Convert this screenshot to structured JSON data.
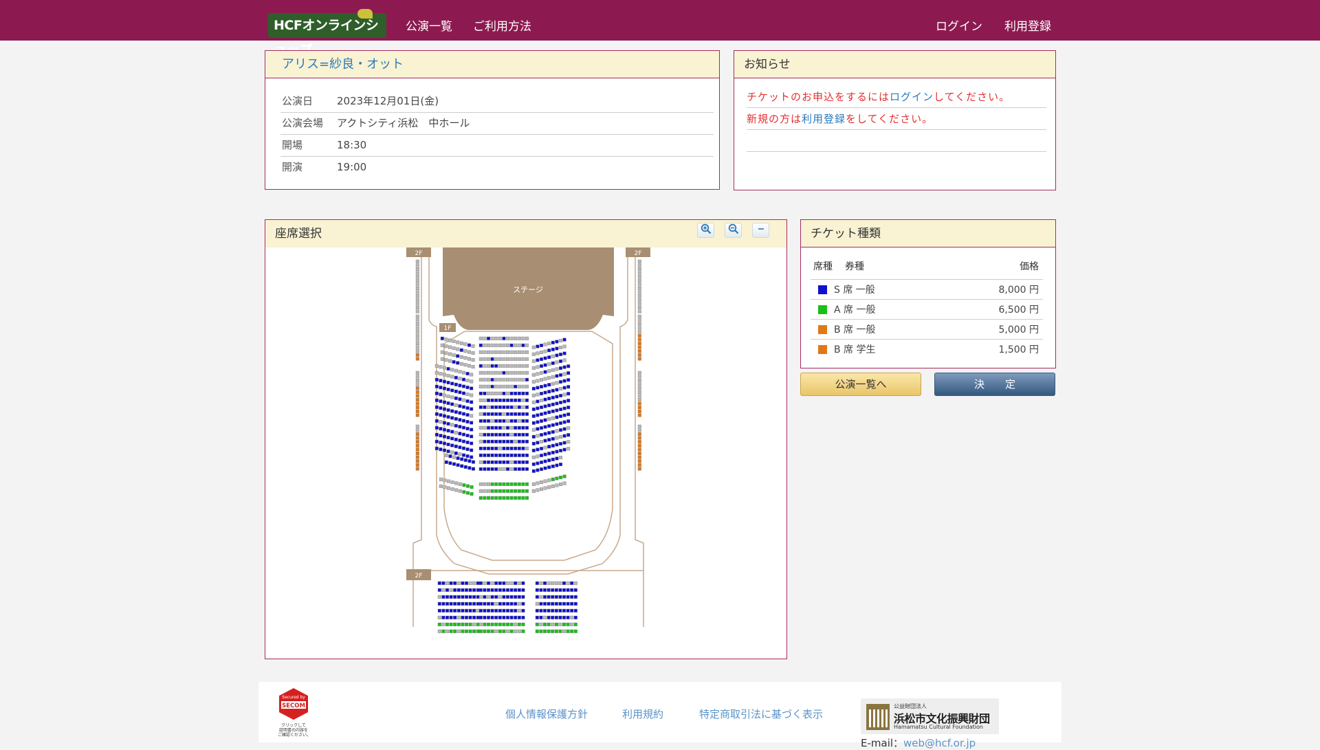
{
  "header": {
    "logo_text": "HCFオンラインショップ",
    "nav": [
      "公演一覧",
      "ご利用方法"
    ],
    "login": "ログイン",
    "register": "利用登録"
  },
  "event": {
    "title": "アリス=紗良・オット",
    "rows": [
      {
        "label": "公演日",
        "value": "2023年12月01日(金)"
      },
      {
        "label": "公演会場",
        "value": "アクトシティ浜松　中ホール"
      },
      {
        "label": "開場",
        "value": "18:30"
      },
      {
        "label": "開演",
        "value": "19:00"
      }
    ]
  },
  "notice": {
    "title": "お知らせ",
    "line1_pre": "チケットのお申込をするには",
    "line1_link": "ログイン",
    "line1_post": "してください。",
    "line2_pre": "新規の方は",
    "line2_link": "利用登録",
    "line2_post": "をしてください。"
  },
  "seat_panel": {
    "title": "座席選択",
    "zoom_in_icon": "zoom-in-icon",
    "zoom_out_icon": "zoom-out-icon",
    "reset_icon": "minus-icon",
    "stage_label": "ステージ",
    "floor_1f": "1F",
    "floor_2f": "2F"
  },
  "ticket_panel": {
    "title": "チケット種類",
    "col_seat": "席種",
    "col_type": "券種",
    "col_price": "価格",
    "rows": [
      {
        "name": "S 席 一般",
        "price": "8,000 円",
        "color": "#1010d0"
      },
      {
        "name": "A 席 一般",
        "price": "6,500 円",
        "color": "#18c018"
      },
      {
        "name": "B 席 一般",
        "price": "5,000 円",
        "color": "#e07818"
      },
      {
        "name": "B 席 学生",
        "price": "1,500 円",
        "color": "#e07818"
      }
    ]
  },
  "buttons": {
    "back": "公演一覧へ",
    "confirm": "決　　定"
  },
  "footer": {
    "links": [
      "個人情報保護方針",
      "利用規約",
      "特定商取引法に基づく表示"
    ],
    "secom_top": "Secured by",
    "secom_brand": "SECOM",
    "secom_text": "クリックして\n証明書の内容を\nご確認ください。",
    "org_small": "公益財団法人",
    "org_name": "浜松市文化振興財団",
    "org_en": "Hamamatsu Cultural Foundation",
    "email_label": "E-mail：",
    "email": "web@hcf.or.jp"
  },
  "colors": {
    "header": "#8c1a50",
    "seat_s": "#1010d0",
    "seat_a": "#18c018",
    "seat_b": "#e07818",
    "seat_sold": "#b8b8b8"
  }
}
